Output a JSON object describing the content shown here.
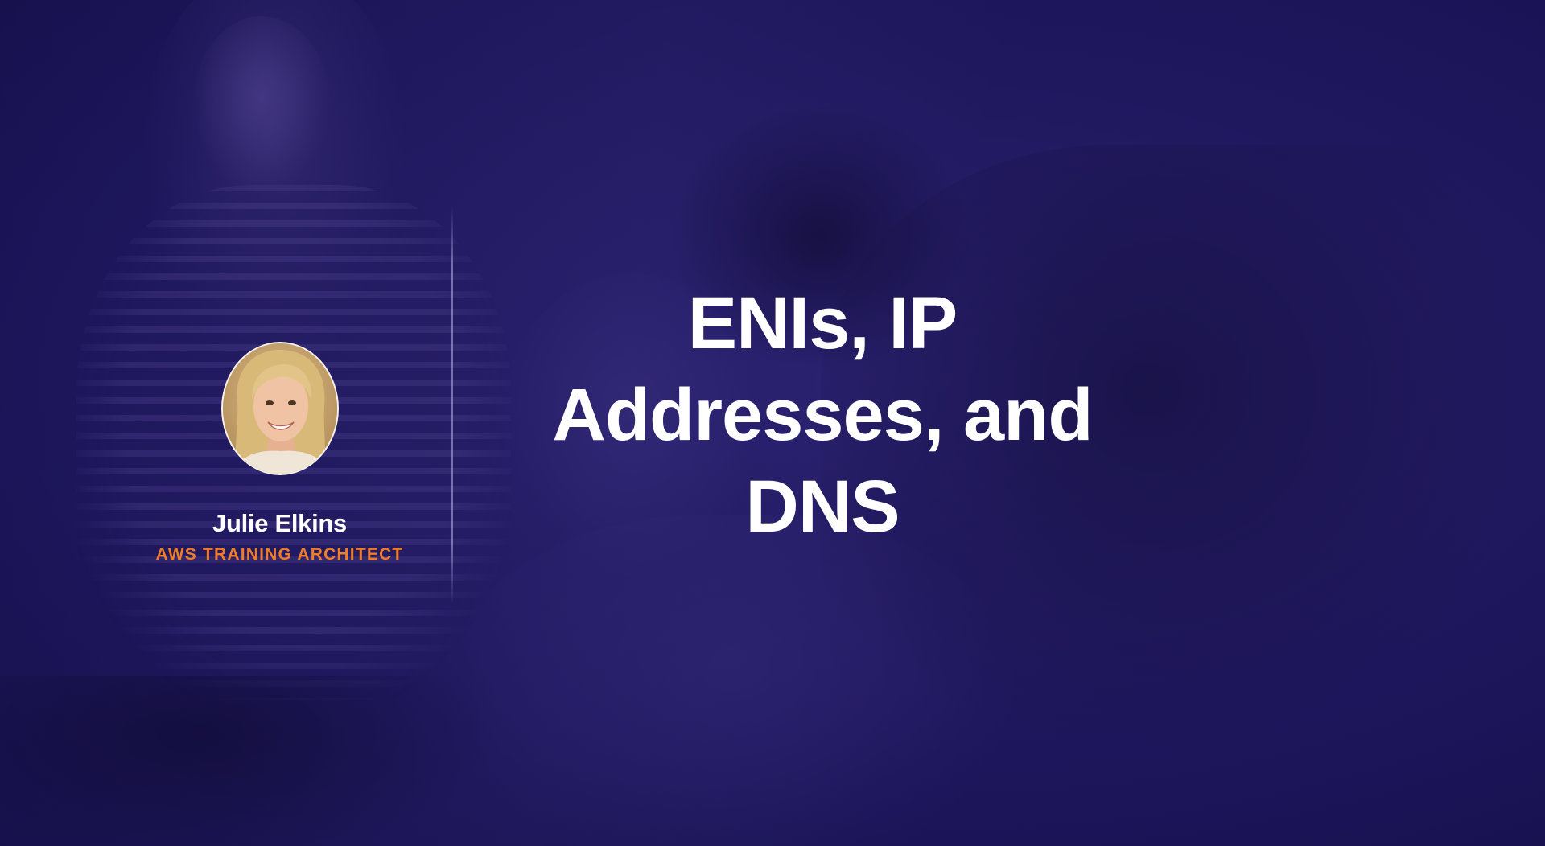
{
  "presenter": {
    "name": "Julie Elkins",
    "role": "AWS TRAINING ARCHITECT",
    "avatar_icon": "presenter-photo"
  },
  "title": {
    "lines": [
      "ENIs, IP",
      "Addresses, and",
      "DNS"
    ]
  },
  "colors": {
    "background": "#1e175c",
    "accent": "#f07c28",
    "text": "#ffffff"
  }
}
